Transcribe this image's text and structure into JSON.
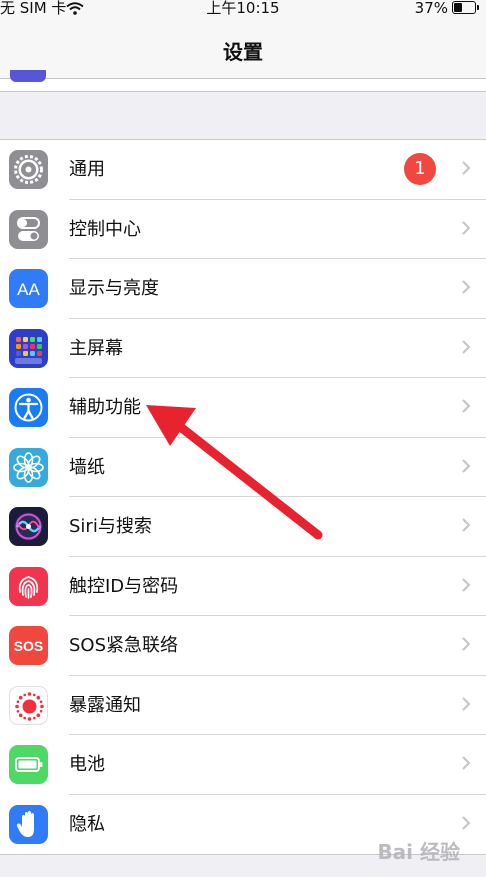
{
  "status_bar": {
    "carrier": "无 SIM 卡",
    "time": "上午10:15",
    "battery_percent": "37%"
  },
  "nav": {
    "title": "设置"
  },
  "settings": [
    {
      "name": "general",
      "label": "通用",
      "icon": "gear-icon",
      "badge": "1"
    },
    {
      "name": "control-center",
      "label": "控制中心",
      "icon": "toggle-icon"
    },
    {
      "name": "display-brightness",
      "label": "显示与亮度",
      "icon": "text-size-icon"
    },
    {
      "name": "home-screen",
      "label": "主屏幕",
      "icon": "app-grid-icon"
    },
    {
      "name": "accessibility",
      "label": "辅助功能",
      "icon": "accessibility-icon"
    },
    {
      "name": "wallpaper",
      "label": "墙纸",
      "icon": "flower-icon"
    },
    {
      "name": "siri-search",
      "label": "Siri与搜索",
      "icon": "siri-icon"
    },
    {
      "name": "touch-id-passcode",
      "label": "触控ID与密码",
      "icon": "fingerprint-icon"
    },
    {
      "name": "emergency-sos",
      "label": "SOS紧急联络",
      "icon": "sos-icon",
      "icon_text": "SOS"
    },
    {
      "name": "exposure-notifications",
      "label": "暴露通知",
      "icon": "exposure-icon"
    },
    {
      "name": "battery",
      "label": "电池",
      "icon": "battery-icon"
    },
    {
      "name": "privacy",
      "label": "隐私",
      "icon": "hand-icon"
    }
  ],
  "colors": {
    "general": "#8e8e93",
    "control_center": "#8e8e93",
    "display": "#2f7cf6",
    "home_screen": "#2c3fc9",
    "accessibility": "#1a7cf5",
    "wallpaper": "#36aadc",
    "siri": "#1b1b3a",
    "touch_id": "#f2354f",
    "sos": "#f0483e",
    "exposure": "#ffffff",
    "battery": "#4cd964",
    "privacy": "#2f7cf6",
    "badge": "#f0483e",
    "annotation_arrow": "#e8232f"
  },
  "watermark": "Bai 经验"
}
